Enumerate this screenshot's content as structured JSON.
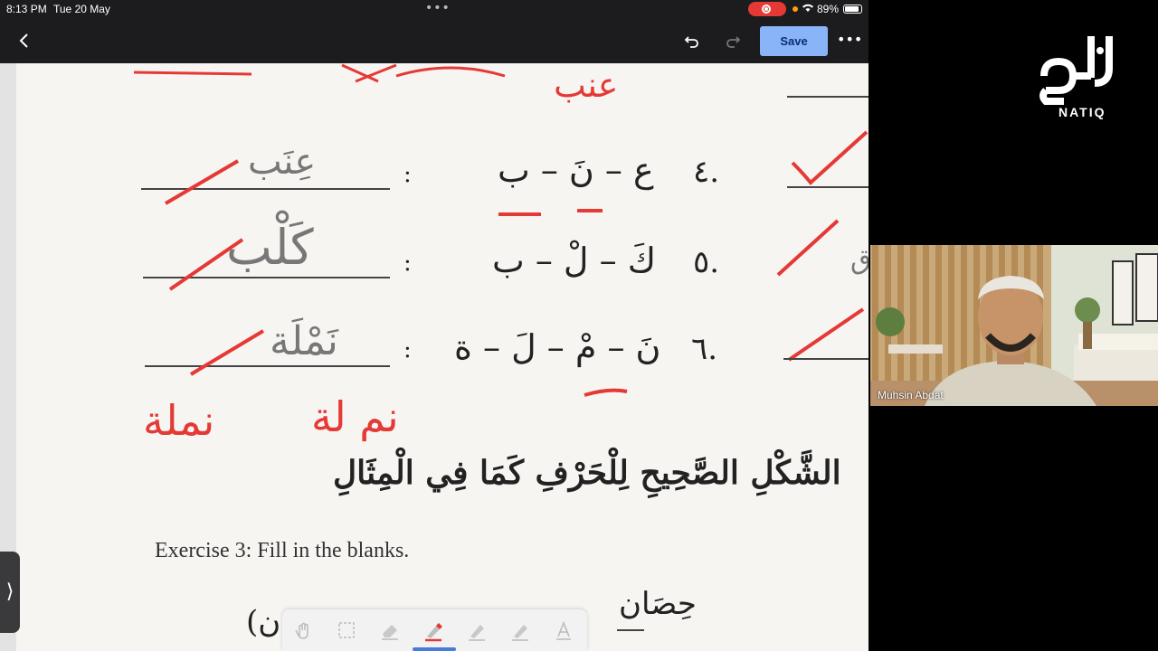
{
  "status_bar": {
    "time": "8:13 PM",
    "date": "Tue 20 May",
    "battery": "89%",
    "battery_level": 0.89
  },
  "toolbar": {
    "save_label": "Save"
  },
  "worksheet": {
    "red_annotation_top": "عنب",
    "rows": [
      {
        "number": "٤.",
        "letters": "ع – نَ – ب",
        "answer": "عِنَب"
      },
      {
        "number": "٥.",
        "letters": "كَ – لْ – ب",
        "answer": "كَلْب"
      },
      {
        "number": "٦.",
        "letters": "نَ – مْ – لَ – ة",
        "answer": "نَمْلَة"
      }
    ],
    "colon": ":",
    "red_annotation_bottom_left": "نملة",
    "red_annotation_bottom_right": "نم لة",
    "instruction_ar": "الشَّكْلِ الصَّحِيحِ لِلْحَرْفِ كَمَا فِي الْمِثَالِ",
    "exercise_title": "Exercise 3: Fill in the blanks.",
    "bottom_word": "حِصَان",
    "bottom_partial": "(ن"
  },
  "webcam": {
    "participant_name": "Muhsin Abdat"
  },
  "logo": {
    "text": "NATIQ",
    "glyph": "ناطق"
  },
  "colors": {
    "save_button": "#8ab4f8",
    "annotation_red": "#e53935",
    "recording": "#e53935"
  }
}
